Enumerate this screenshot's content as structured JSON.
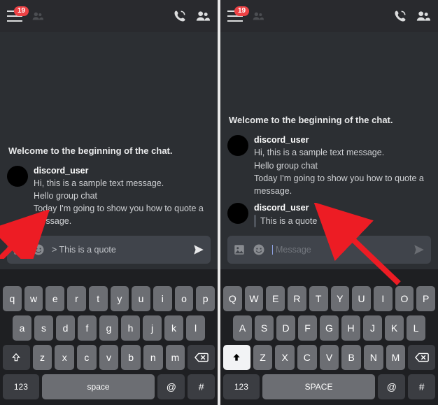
{
  "header": {
    "badge_count": "19"
  },
  "left": {
    "welcome": "Welcome to the beginning of the chat.",
    "msg1": {
      "user": "discord_user",
      "l1": "Hi, this is a sample text message.",
      "l2": "Hello group chat",
      "l3": "Today I'm going to show you how to quote a message."
    },
    "composer_text": "> This is a quote"
  },
  "right": {
    "welcome": "Welcome to the beginning of the chat.",
    "msg1": {
      "user": "discord_user",
      "l1": "Hi, this is a sample text message.",
      "l2": "Hello group chat",
      "l3": "Today I'm going to show you how to quote a message."
    },
    "msg2": {
      "user": "discord_user",
      "quote": "This is a quote"
    },
    "composer_placeholder": "Message"
  },
  "kbd": {
    "r1": [
      "q",
      "w",
      "e",
      "r",
      "t",
      "y",
      "u",
      "i",
      "o",
      "p"
    ],
    "r2": [
      "a",
      "s",
      "d",
      "f",
      "g",
      "h",
      "j",
      "k",
      "l"
    ],
    "r3": [
      "z",
      "x",
      "c",
      "v",
      "b",
      "n",
      "m"
    ],
    "k123": "123",
    "space": "space",
    "at": "@",
    "hash": "#"
  }
}
